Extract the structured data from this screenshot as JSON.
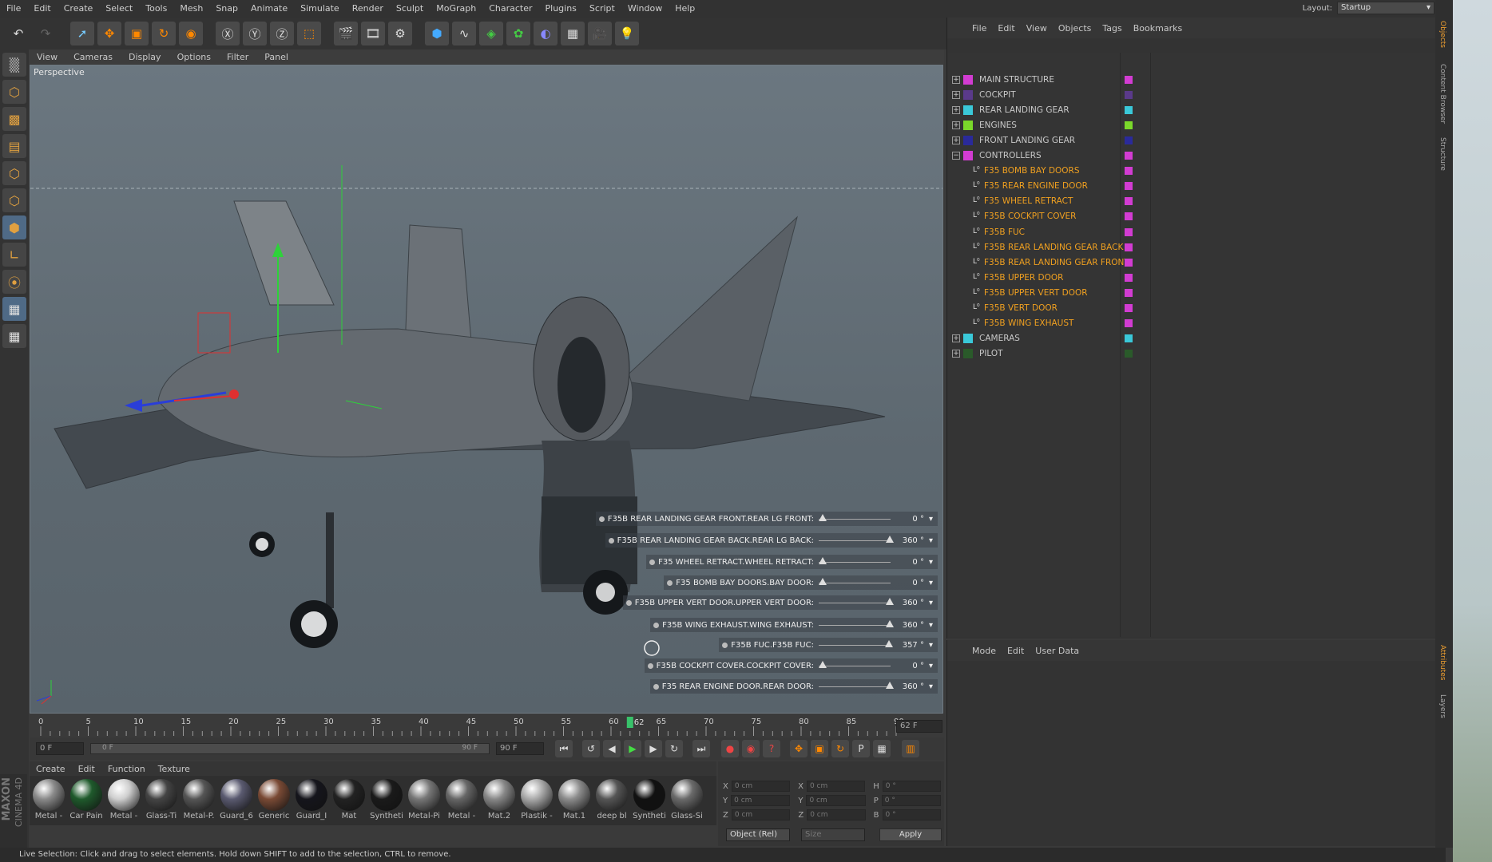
{
  "menubar": {
    "items": [
      "File",
      "Edit",
      "Create",
      "Select",
      "Tools",
      "Mesh",
      "Snap",
      "Animate",
      "Simulate",
      "Render",
      "Sculpt",
      "MoGraph",
      "Character",
      "Plugins",
      "Script",
      "Window",
      "Help"
    ],
    "layout_label": "Layout:",
    "layout_value": "Startup"
  },
  "viewport": {
    "menu": [
      "View",
      "Cameras",
      "Display",
      "Options",
      "Filter",
      "Panel"
    ],
    "label": "Perspective"
  },
  "controls": [
    {
      "label": "F35B REAR LANDING GEAR FRONT.REAR LG FRONT:",
      "value": "0 °",
      "fraction": 0.0
    },
    {
      "label": "F35B REAR LANDING GEAR BACK.REAR LG BACK:",
      "value": "360 °",
      "fraction": 1.0
    },
    {
      "label": "F35 WHEEL RETRACT.WHEEL RETRACT:",
      "value": "0 °",
      "fraction": 0.0
    },
    {
      "label": "F35 BOMB BAY DOORS.BAY DOOR:",
      "value": "0 °",
      "fraction": 0.0
    },
    {
      "label": "F35B UPPER VERT DOOR.UPPER VERT DOOR:",
      "value": "360 °",
      "fraction": 1.0
    },
    {
      "label": "F35B WING EXHAUST.WING EXHAUST:",
      "value": "360 °",
      "fraction": 1.0
    },
    {
      "label": "F35B FUC.F35B FUC:",
      "value": "357 °",
      "fraction": 0.99
    },
    {
      "label": "F35B COCKPIT COVER.COCKPIT COVER:",
      "value": "0 °",
      "fraction": 0.0
    },
    {
      "label": "F35 REAR ENGINE DOOR.REAR DOOR:",
      "value": "360 °",
      "fraction": 1.0
    }
  ],
  "timeline": {
    "ticks": [
      "0",
      "5",
      "10",
      "15",
      "20",
      "25",
      "30",
      "35",
      "40",
      "45",
      "50",
      "55",
      "60",
      "65",
      "70",
      "75",
      "80",
      "85",
      "90"
    ],
    "current": "62",
    "end_field": "62 F"
  },
  "transport": {
    "start": "0 F",
    "range_start": "0 F",
    "range_end": "90 F",
    "max": "90 F"
  },
  "materials_menu": [
    "Create",
    "Edit",
    "Function",
    "Texture"
  ],
  "materials": [
    {
      "name": "Metal -",
      "color": "#8a8a8a"
    },
    {
      "name": "Car Pain",
      "color": "#1f5a2c"
    },
    {
      "name": "Metal -",
      "color": "#cfcfcf"
    },
    {
      "name": "Glass-Ti",
      "color": "#444"
    },
    {
      "name": "Metal-P.",
      "color": "#555"
    },
    {
      "name": "Guard_6",
      "color": "#5a5a70"
    },
    {
      "name": "Generic",
      "color": "#7a4a35"
    },
    {
      "name": "Guard_I",
      "color": "#15151c"
    },
    {
      "name": "Mat",
      "color": "#222"
    },
    {
      "name": "Syntheti",
      "color": "#1a1a1a"
    },
    {
      "name": "Metal-Pi",
      "color": "#777"
    },
    {
      "name": "Metal - ",
      "color": "#666"
    },
    {
      "name": "Mat.2",
      "color": "#888"
    },
    {
      "name": "Plastik -",
      "color": "#aaa"
    },
    {
      "name": "Mat.1",
      "color": "#8c8c8c"
    },
    {
      "name": "deep bl",
      "color": "#555"
    },
    {
      "name": "Syntheti",
      "color": "#111"
    },
    {
      "name": "Glass-Si",
      "color": "#6a6a6a"
    }
  ],
  "coords": {
    "rows": [
      {
        "a": "X",
        "av": "0 cm",
        "b": "X",
        "bv": "0 cm",
        "c": "H",
        "cv": "0 °"
      },
      {
        "a": "Y",
        "av": "0 cm",
        "b": "Y",
        "bv": "0 cm",
        "c": "P",
        "cv": "0 °"
      },
      {
        "a": "Z",
        "av": "0 cm",
        "b": "Z",
        "bv": "0 cm",
        "c": "B",
        "cv": "0 °"
      }
    ],
    "mode": "Object (Rel)",
    "size": "Size",
    "apply": "Apply"
  },
  "objects_menu": [
    "File",
    "Edit",
    "View",
    "Objects",
    "Tags",
    "Bookmarks"
  ],
  "objects": [
    {
      "label": "MAIN STRUCTURE",
      "color": "#d23cd2",
      "child": false,
      "highlight": false
    },
    {
      "label": "COCKPIT",
      "color": "#5a3a8a",
      "child": false,
      "highlight": false
    },
    {
      "label": "REAR LANDING GEAR",
      "color": "#3ac8d8",
      "child": false,
      "highlight": false
    },
    {
      "label": "ENGINES",
      "color": "#7ad82a",
      "child": false,
      "highlight": false
    },
    {
      "label": "FRONT LANDING GEAR",
      "color": "#2a2a9a",
      "child": false,
      "highlight": false
    },
    {
      "label": "CONTROLLERS",
      "color": "#d23cd2",
      "child": false,
      "highlight": false
    },
    {
      "label": "F35 BOMB BAY DOORS",
      "color": "#d23cd2",
      "child": true,
      "highlight": true
    },
    {
      "label": "F35 REAR ENGINE DOOR",
      "color": "#d23cd2",
      "child": true,
      "highlight": true
    },
    {
      "label": "F35 WHEEL RETRACT",
      "color": "#d23cd2",
      "child": true,
      "highlight": true
    },
    {
      "label": "F35B COCKPIT COVER",
      "color": "#d23cd2",
      "child": true,
      "highlight": true
    },
    {
      "label": "F35B FUC",
      "color": "#d23cd2",
      "child": true,
      "highlight": true
    },
    {
      "label": "F35B REAR LANDING GEAR BACK",
      "color": "#d23cd2",
      "child": true,
      "highlight": true
    },
    {
      "label": "F35B REAR LANDING GEAR FRONT",
      "color": "#d23cd2",
      "child": true,
      "highlight": true
    },
    {
      "label": "F35B UPPER DOOR",
      "color": "#d23cd2",
      "child": true,
      "highlight": true
    },
    {
      "label": "F35B UPPER VERT DOOR",
      "color": "#d23cd2",
      "child": true,
      "highlight": true
    },
    {
      "label": "F35B VERT DOOR",
      "color": "#d23cd2",
      "child": true,
      "highlight": true
    },
    {
      "label": "F35B WING EXHAUST",
      "color": "#d23cd2",
      "child": true,
      "highlight": true
    },
    {
      "label": "CAMERAS",
      "color": "#3ac8d8",
      "child": false,
      "highlight": false
    },
    {
      "label": "PILOT",
      "color": "#2a5a2a",
      "child": false,
      "highlight": false
    }
  ],
  "attributes_menu": [
    "Mode",
    "Edit",
    "User Data"
  ],
  "right_tabs": [
    "Objects",
    "Content Browser",
    "Structure",
    "Attributes",
    "Layers"
  ],
  "status": "Live Selection: Click and drag to select elements. Hold down SHIFT to add to the selection, CTRL to remove.",
  "brand": [
    "MAXON",
    "CINEMA 4D"
  ]
}
